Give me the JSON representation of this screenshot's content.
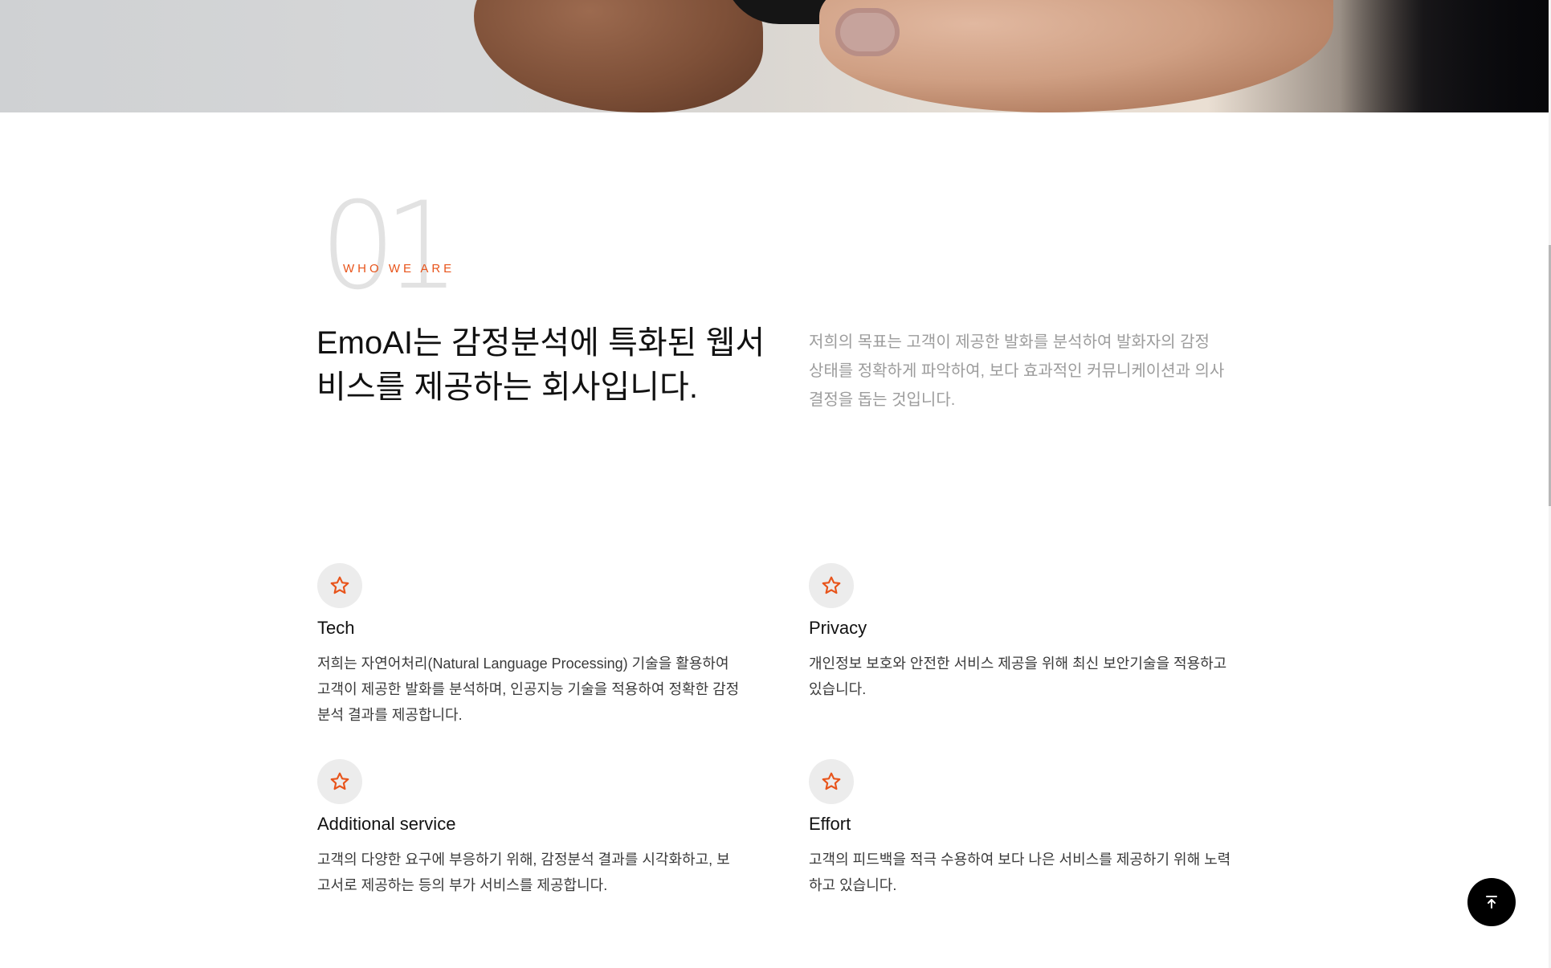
{
  "section": {
    "number": "01",
    "eyebrow": "WHO WE ARE",
    "headline": "EmoAI는 감정분석에 특화된 웹서비스를 제공하는 회사입니다.",
    "intro": "저희의 목표는 고객이 제공한 발화를 분석하여 발화자의 감정 상태를 정확하게 파악하여, 보다 효과적인 커뮤니케이션과 의사결정을 돕는 것입니다."
  },
  "features": [
    {
      "icon": "star-icon",
      "title": "Tech",
      "description": "저희는 자연어처리(Natural Language Processing) 기술을 활용하여 고객이 제공한 발화를 분석하며, 인공지능 기술을 적용하여 정확한 감정분석 결과를 제공합니다."
    },
    {
      "icon": "star-icon",
      "title": "Privacy",
      "description": "개인정보 보호와 안전한 서비스 제공을 위해 최신 보안기술을 적용하고 있습니다."
    },
    {
      "icon": "star-icon",
      "title": "Additional service",
      "description": "고객의 다양한 요구에 부응하기 위해, 감정분석 결과를 시각화하고, 보고서로 제공하는 등의 부가 서비스를 제공합니다."
    },
    {
      "icon": "star-icon",
      "title": "Effort",
      "description": "고객의 피드백을 적극 수용하여 보다 나은 서비스를 제공하기 위해 노력하고 있습니다."
    }
  ],
  "back_to_top": {
    "icon": "arrow-up-to-line-icon"
  },
  "colors": {
    "accent": "#e8541b",
    "icon_circle": "#ececec",
    "muted_text": "#9c9c9c",
    "number_watermark": "#e2e2e2",
    "button_bg": "#000000"
  }
}
